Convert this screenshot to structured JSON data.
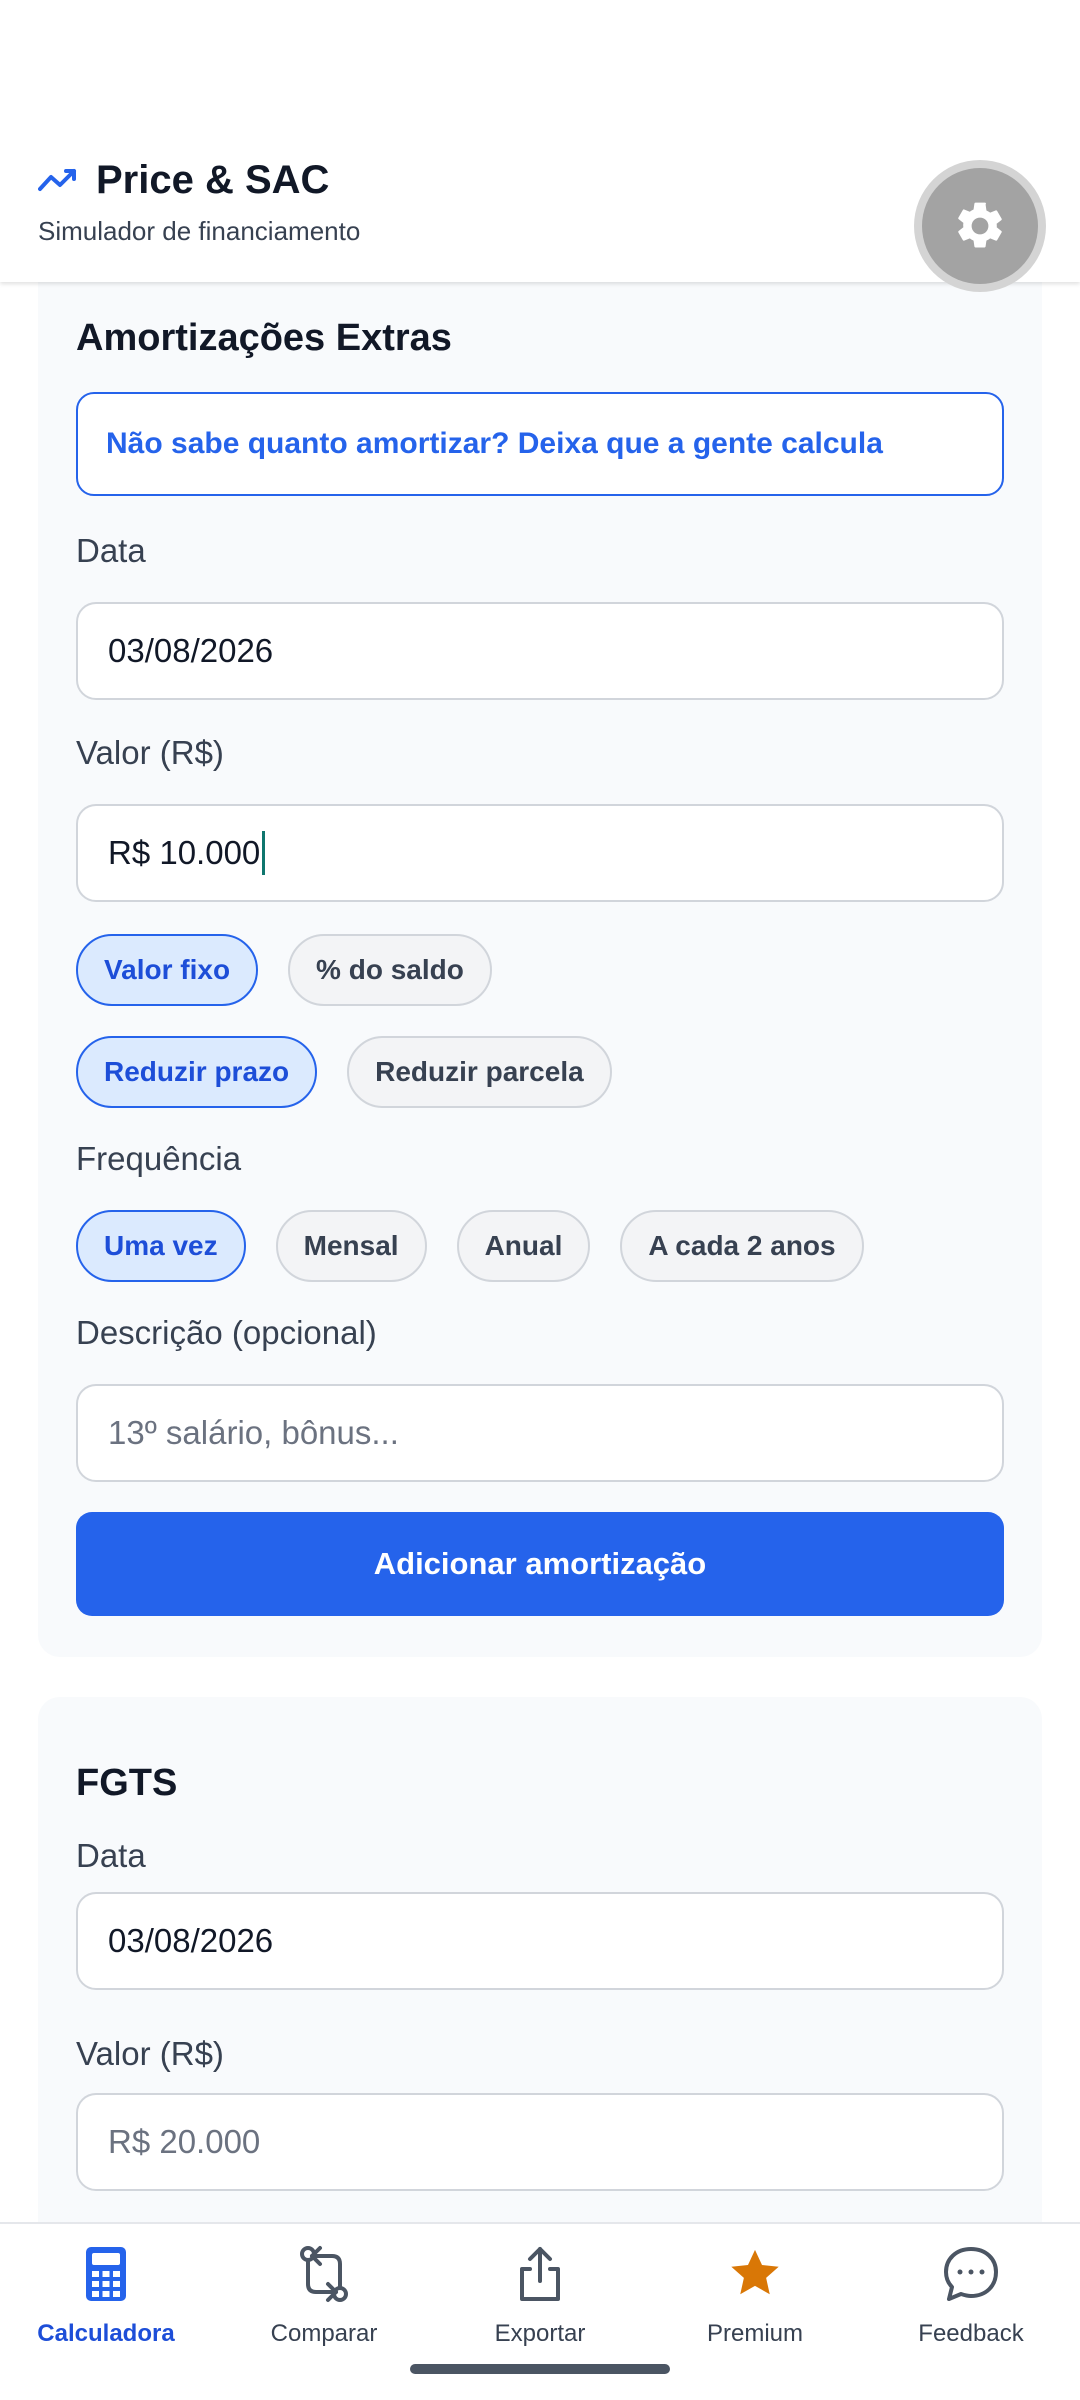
{
  "header": {
    "title": "Price & SAC",
    "subtitle": "Simulador de financiamento"
  },
  "extra_amortization": {
    "section_title": "Amortizações Extras",
    "hint_text": "Não sabe quanto amortizar? Deixa que a gente calcula",
    "date_label": "Data",
    "date_value": "03/08/2026",
    "value_label": "Valor (R$)",
    "value_value": "R$ 10.000",
    "value_type_chips": [
      {
        "label": "Valor fixo",
        "selected": true
      },
      {
        "label": "% do saldo",
        "selected": false
      }
    ],
    "reduction_chips": [
      {
        "label": "Reduzir prazo",
        "selected": true
      },
      {
        "label": "Reduzir parcela",
        "selected": false
      }
    ],
    "frequency_label": "Frequência",
    "frequency_chips": [
      {
        "label": "Uma vez",
        "selected": true
      },
      {
        "label": "Mensal",
        "selected": false
      },
      {
        "label": "Anual",
        "selected": false
      },
      {
        "label": "A cada 2 anos",
        "selected": false
      }
    ],
    "description_label": "Descrição (opcional)",
    "description_placeholder": "13º salário, bônus...",
    "add_button": "Adicionar amortização"
  },
  "fgts": {
    "section_title": "FGTS",
    "date_label": "Data",
    "date_value": "03/08/2026",
    "value_label": "Valor (R$)",
    "value_placeholder": "R$ 20.000"
  },
  "bottom_nav": {
    "items": [
      {
        "label": "Calculadora",
        "icon": "calculator-icon",
        "active": true
      },
      {
        "label": "Comparar",
        "icon": "compare-icon",
        "active": false
      },
      {
        "label": "Exportar",
        "icon": "share-icon",
        "active": false
      },
      {
        "label": "Premium",
        "icon": "star-icon",
        "active": false
      },
      {
        "label": "Feedback",
        "icon": "chat-icon",
        "active": false
      }
    ]
  },
  "colors": {
    "primary": "#2563eb",
    "premium": "#d97706"
  }
}
